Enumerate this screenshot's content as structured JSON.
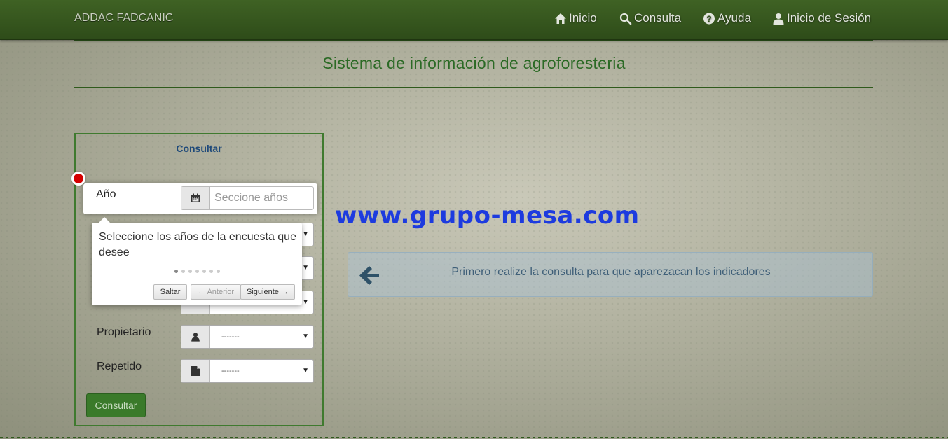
{
  "navbar": {
    "brand": "ADDAC FADCANIC",
    "items": [
      {
        "label": "Inicio",
        "icon": "home-icon"
      },
      {
        "label": "Consulta",
        "icon": "search-icon"
      },
      {
        "label": "Ayuda",
        "icon": "question-icon"
      },
      {
        "label": "Inicio de Sesión",
        "icon": "user-icon"
      }
    ]
  },
  "page": {
    "title": "Sistema de información de agroforesteria"
  },
  "form": {
    "title": "Consultar",
    "fields": [
      {
        "label": "Año",
        "placeholder": "Seccione años",
        "icon": "calendar-icon"
      },
      {
        "label": "Propietario",
        "value": "-------",
        "icon": "user-icon"
      },
      {
        "label": "Repetido",
        "value": "-------",
        "icon": "file-icon"
      }
    ],
    "submit_label": "Consultar"
  },
  "tour": {
    "text": "Seleccione los años de la encuesta que desee",
    "steps_total": 7,
    "current_step": 1,
    "skip_label": "Saltar",
    "prev_label": "← Anterior",
    "next_label": "Siguiente →"
  },
  "watermark": "www.grupo-mesa.com",
  "alert": {
    "text": "Primero realize la consulta para que aparezacan los indicadores",
    "icon": "arrow-left-icon"
  },
  "colors": {
    "navbar": "#2e4c19",
    "accent_green": "#2b6a25",
    "button_green": "#3a7a2a",
    "watermark_blue": "#1d3bdf",
    "marker_red": "#d40000"
  }
}
